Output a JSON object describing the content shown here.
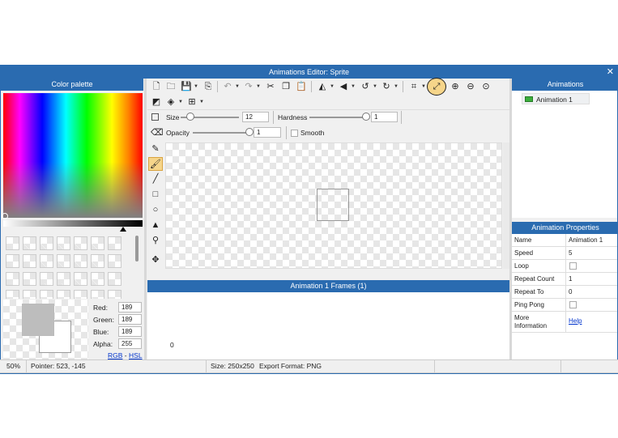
{
  "window": {
    "title": "Animations Editor: Sprite",
    "close": "✕"
  },
  "color_palette": {
    "title": "Color palette",
    "red_label": "Red:",
    "red": "189",
    "green_label": "Green:",
    "green": "189",
    "blue_label": "Blue:",
    "blue": "189",
    "alpha_label": "Alpha:",
    "alpha": "255",
    "rgb_link": "RGB",
    "dash": "-",
    "hsl_link": "HSL",
    "current_color": "#bdbdbd"
  },
  "toolbar": {
    "size_label": "Size",
    "size_value": "12",
    "hardness_label": "Hardness",
    "hardness_value": "1",
    "opacity_label": "Opacity",
    "opacity_value": "1",
    "smooth_label": "Smooth"
  },
  "frames": {
    "title": "Animation 1 Frames (1)",
    "frame_index": "0"
  },
  "animations": {
    "title": "Animations",
    "items": [
      "Animation 1"
    ]
  },
  "properties": {
    "title": "Animation Properties",
    "rows": [
      {
        "key": "Name",
        "value": "Animation 1"
      },
      {
        "key": "Speed",
        "value": "5"
      },
      {
        "key": "Loop",
        "value": ""
      },
      {
        "key": "Repeat Count",
        "value": "1"
      },
      {
        "key": "Repeat To",
        "value": "0"
      },
      {
        "key": "Ping Pong",
        "value": ""
      },
      {
        "key": "More Information",
        "value": "Help"
      }
    ]
  },
  "status": {
    "zoom": "50%",
    "pointer": "Pointer: 523, -145",
    "size": "Size: 250x250",
    "export": "Export Format: PNG"
  },
  "colors": {
    "accent": "#2a6bb0",
    "highlight": "#f6d58a"
  }
}
